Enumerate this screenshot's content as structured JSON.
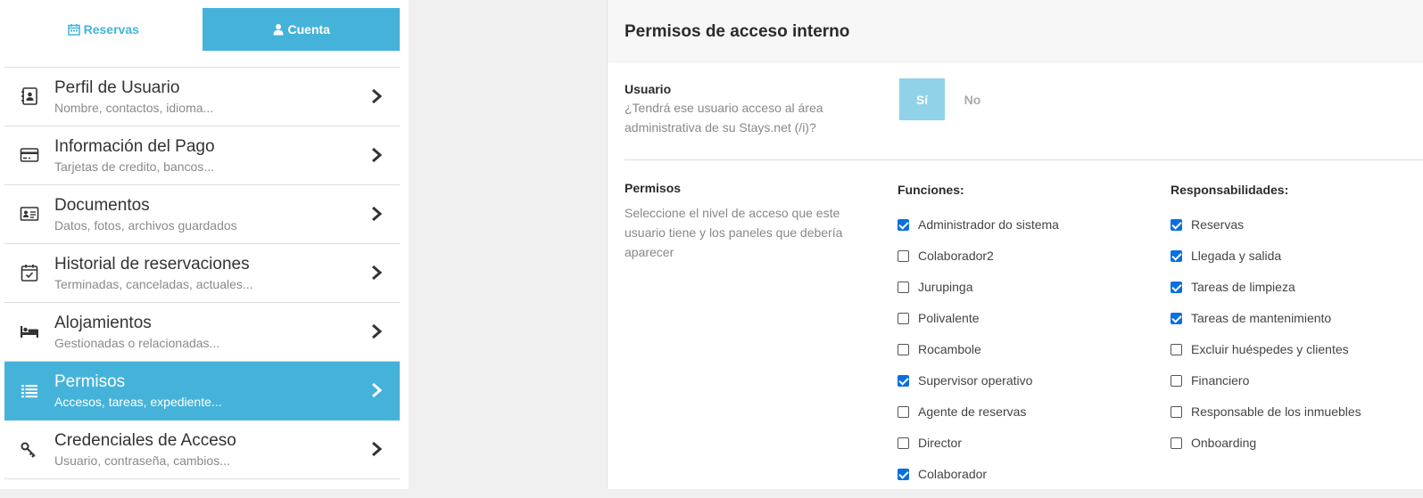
{
  "tabs": [
    {
      "label": "Reservas",
      "icon": "calendar-icon",
      "active": false
    },
    {
      "label": "Cuenta",
      "icon": "user-icon",
      "active": true
    }
  ],
  "menu": [
    {
      "title": "Perfil de Usuario",
      "subtitle": "Nombre, contactos, idioma...",
      "icon": "contact-book-icon",
      "active": false
    },
    {
      "title": "Información del Pago",
      "subtitle": "Tarjetas de credito, bancos...",
      "icon": "credit-card-icon",
      "active": false
    },
    {
      "title": "Documentos",
      "subtitle": "Datos, fotos, archivos guardados",
      "icon": "id-card-icon",
      "active": false
    },
    {
      "title": "Historial de reservaciones",
      "subtitle": "Terminadas, canceladas, actuales...",
      "icon": "calendar-check-icon",
      "active": false
    },
    {
      "title": "Alojamientos",
      "subtitle": "Gestionadas o relacionadas...",
      "icon": "bed-icon",
      "active": false
    },
    {
      "title": "Permisos",
      "subtitle": "Accesos, tareas, expediente...",
      "icon": "list-icon",
      "active": true
    },
    {
      "title": "Credenciales de Acceso",
      "subtitle": "Usuario, contraseña, cambios...",
      "icon": "key-icon",
      "active": false
    }
  ],
  "panel": {
    "title": "Permisos de acceso interno",
    "usuario": {
      "label": "Usuario",
      "description": "¿Tendrá ese usuario acceso al área administrativa de su Stays.net (/i)?",
      "yes_label": "Sí",
      "no_label": "No",
      "selected": "Sí"
    },
    "permisos": {
      "label": "Permisos",
      "description": "Seleccione el nivel de acceso que este usuario tiene y los paneles que debería aparecer"
    },
    "funciones": {
      "heading": "Funciones:",
      "items": [
        {
          "label": "Administrador do sistema",
          "checked": true
        },
        {
          "label": "Colaborador2",
          "checked": false
        },
        {
          "label": "Jurupinga",
          "checked": false
        },
        {
          "label": "Polivalente",
          "checked": false
        },
        {
          "label": "Rocambole",
          "checked": false
        },
        {
          "label": "Supervisor operativo",
          "checked": true
        },
        {
          "label": "Agente de reservas",
          "checked": false
        },
        {
          "label": "Director",
          "checked": false
        },
        {
          "label": "Colaborador",
          "checked": true
        }
      ]
    },
    "responsabilidades": {
      "heading": "Responsabilidades:",
      "items": [
        {
          "label": "Reservas",
          "checked": true
        },
        {
          "label": "Llegada y salida",
          "checked": true
        },
        {
          "label": "Tareas de limpieza",
          "checked": true
        },
        {
          "label": "Tareas de mantenimiento",
          "checked": true
        },
        {
          "label": "Excluir huéspedes y clientes",
          "checked": false
        },
        {
          "label": "Financiero",
          "checked": false
        },
        {
          "label": "Responsable de los inmuebles",
          "checked": false
        },
        {
          "label": "Onboarding",
          "checked": false
        }
      ]
    }
  },
  "colors": {
    "accent": "#45b3d9",
    "toggle_active": "#90d2e8",
    "checkbox": "#0a6fe0"
  }
}
